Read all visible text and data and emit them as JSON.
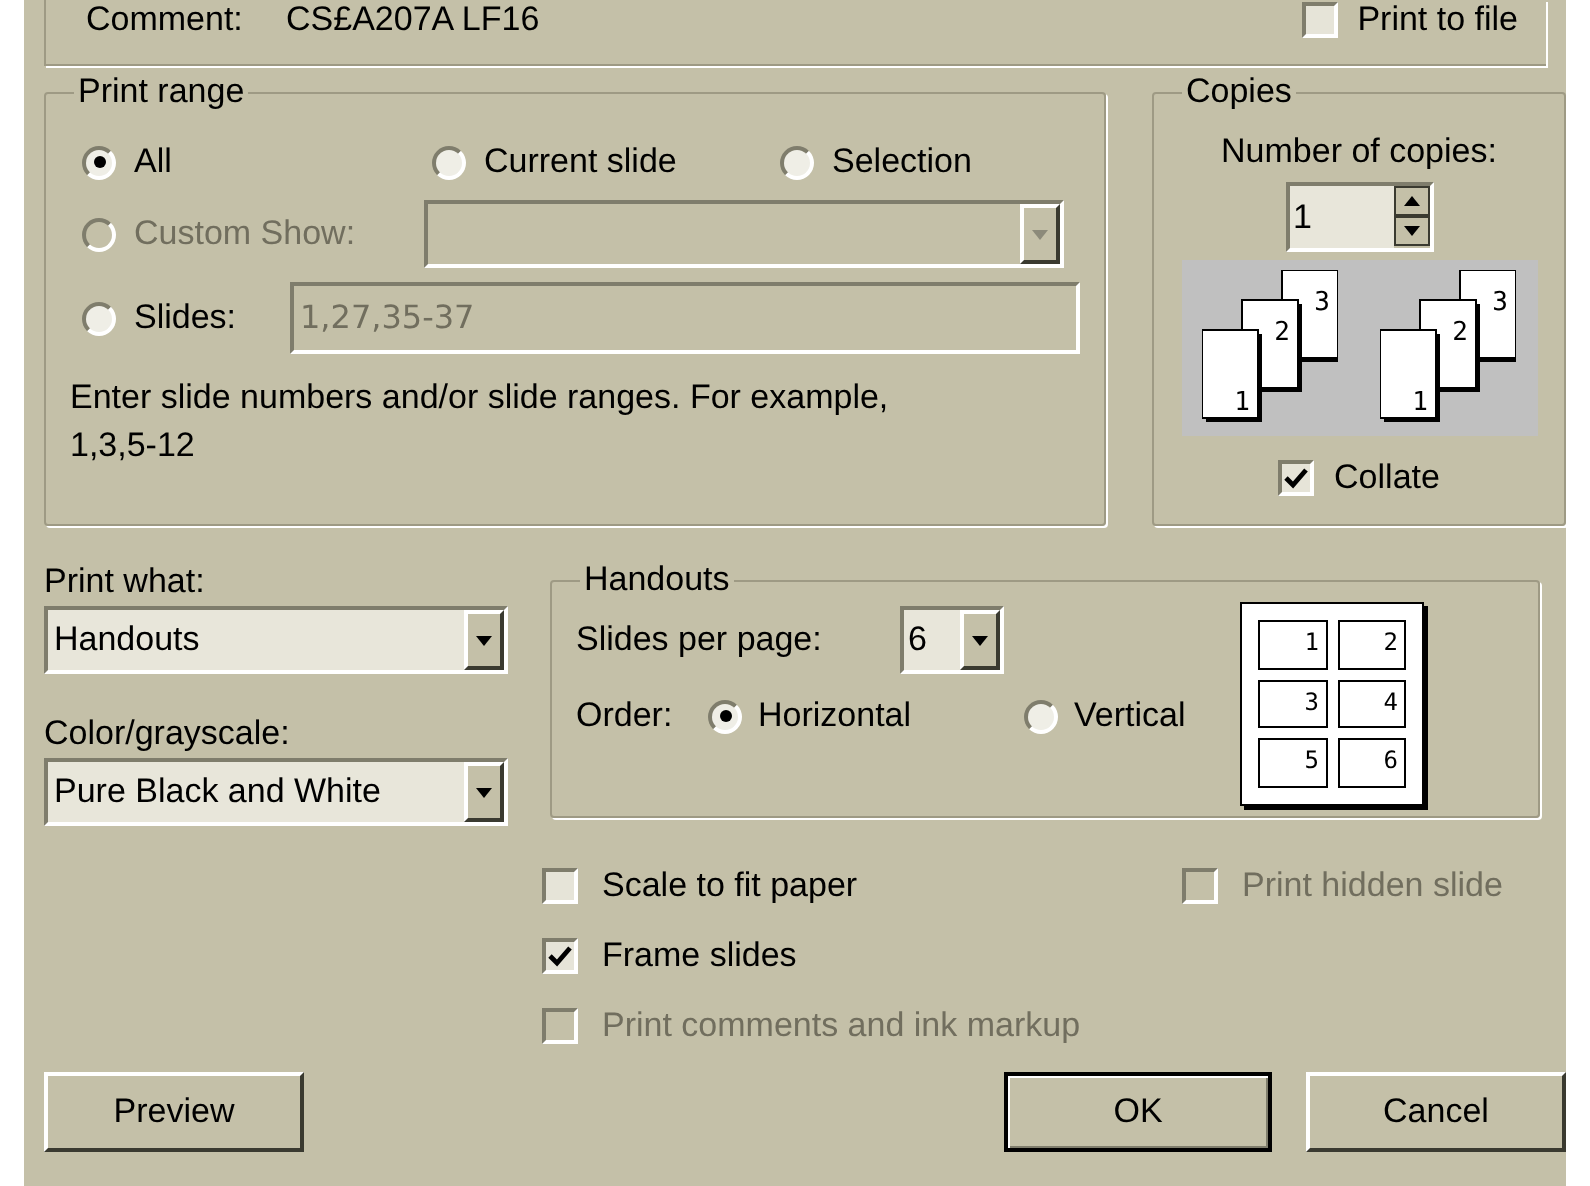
{
  "comment": {
    "label": "Comment:",
    "value": "CS£A207A LF16"
  },
  "print_to_file": {
    "label": "Print to file",
    "checked": false
  },
  "print_range": {
    "title": "Print range",
    "options": [
      {
        "label": "All",
        "selected": true
      },
      {
        "label": "Current slide",
        "selected": false
      },
      {
        "label": "Selection",
        "selected": false
      }
    ],
    "custom_show": {
      "label": "Custom Show:",
      "selected": false,
      "disabled": true
    },
    "slides": {
      "label": "Slides:",
      "selected": false,
      "value": "1,27,35-37"
    },
    "hint": "Enter slide numbers and/or slide ranges. For example, 1,3,5-12"
  },
  "copies": {
    "title": "Copies",
    "label": "Number of copies:",
    "value": "1",
    "illustrations": [
      {
        "pages": [
          "1",
          "2",
          "3"
        ]
      },
      {
        "pages": [
          "1",
          "2",
          "3"
        ]
      }
    ],
    "collate": {
      "label": "Collate",
      "checked": true
    }
  },
  "print_what": {
    "label": "Print what:",
    "value": "Handouts"
  },
  "color_grayscale": {
    "label": "Color/grayscale:",
    "value": "Pure Black and White"
  },
  "handouts": {
    "title": "Handouts",
    "slides_per_page_label": "Slides per page:",
    "slides_per_page": "6",
    "order_label": "Order:",
    "order_options": [
      {
        "label": "Horizontal",
        "selected": true
      },
      {
        "label": "Vertical",
        "selected": false
      }
    ],
    "preview_numbers": [
      "1",
      "2",
      "3",
      "4",
      "5",
      "6"
    ]
  },
  "checkboxes": [
    {
      "label": "Scale to fit paper",
      "checked": false,
      "disabled": false
    },
    {
      "label": "Frame slides",
      "checked": true,
      "disabled": false
    },
    {
      "label": "Print comments and ink markup",
      "checked": false,
      "disabled": true
    }
  ],
  "print_hidden_slides": {
    "label": "Print hidden slide",
    "checked": false,
    "disabled": true
  },
  "buttons": [
    {
      "label": "Preview",
      "default": false
    },
    {
      "label": "OK",
      "default": true
    },
    {
      "label": "Cancel",
      "default": false
    }
  ]
}
